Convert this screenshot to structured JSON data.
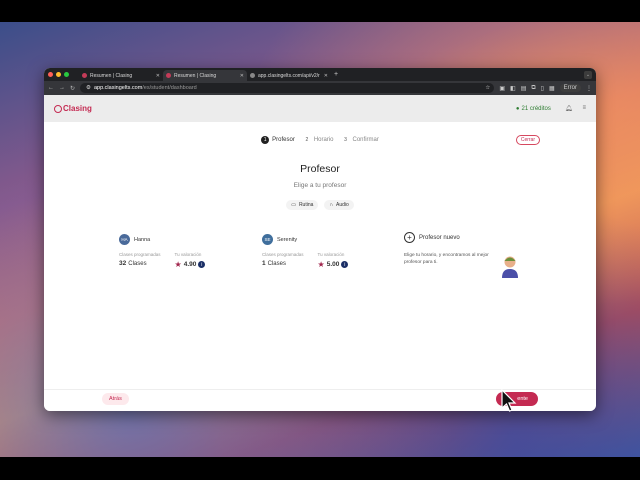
{
  "tabs": [
    {
      "label": "Resumen | Clasing",
      "active": false
    },
    {
      "label": "Resumen | Clasing",
      "active": true
    },
    {
      "label": "app.clasingelts.com/api/v2/r",
      "active": false
    }
  ],
  "urlbar": {
    "host": "app.clasingelts.com",
    "path": "/es/student/dashboard",
    "error_label": "Error"
  },
  "header": {
    "logo": "Clasing",
    "credits": "21 créditos"
  },
  "wizard": {
    "steps": [
      {
        "num": "1",
        "label": "Profesor"
      },
      {
        "num": "2",
        "label": "Horario"
      },
      {
        "num": "3",
        "label": "Confirmar"
      }
    ],
    "close_label": "Cerrar",
    "title": "Profesor",
    "subtitle": "Elige a tu profesor",
    "filters": [
      {
        "label": "Rutina",
        "icon": "book-icon"
      },
      {
        "label": "Audio",
        "icon": "headphones-icon"
      }
    ],
    "teachers": [
      {
        "initials": "HA",
        "name": "Hanna",
        "classes_label": "Clases programadas",
        "classes_count": "32",
        "classes_unit": "Clases",
        "rating_label": "Tu valoración",
        "rating": "4.90"
      },
      {
        "initials": "SE",
        "name": "Serenity",
        "classes_label": "Clases programadas",
        "classes_count": "1",
        "classes_unit": "Clases",
        "rating_label": "Tu valoración",
        "rating": "5.00"
      }
    ],
    "new_teacher": {
      "title": "Profesor nuevo",
      "description": "Elige tu horario, y encontramos al mejor profesor para ti."
    },
    "back_label": "Atrás",
    "next_label": "ente"
  },
  "colors": {
    "brand": "#c42a52",
    "navy": "#1b2f66"
  }
}
